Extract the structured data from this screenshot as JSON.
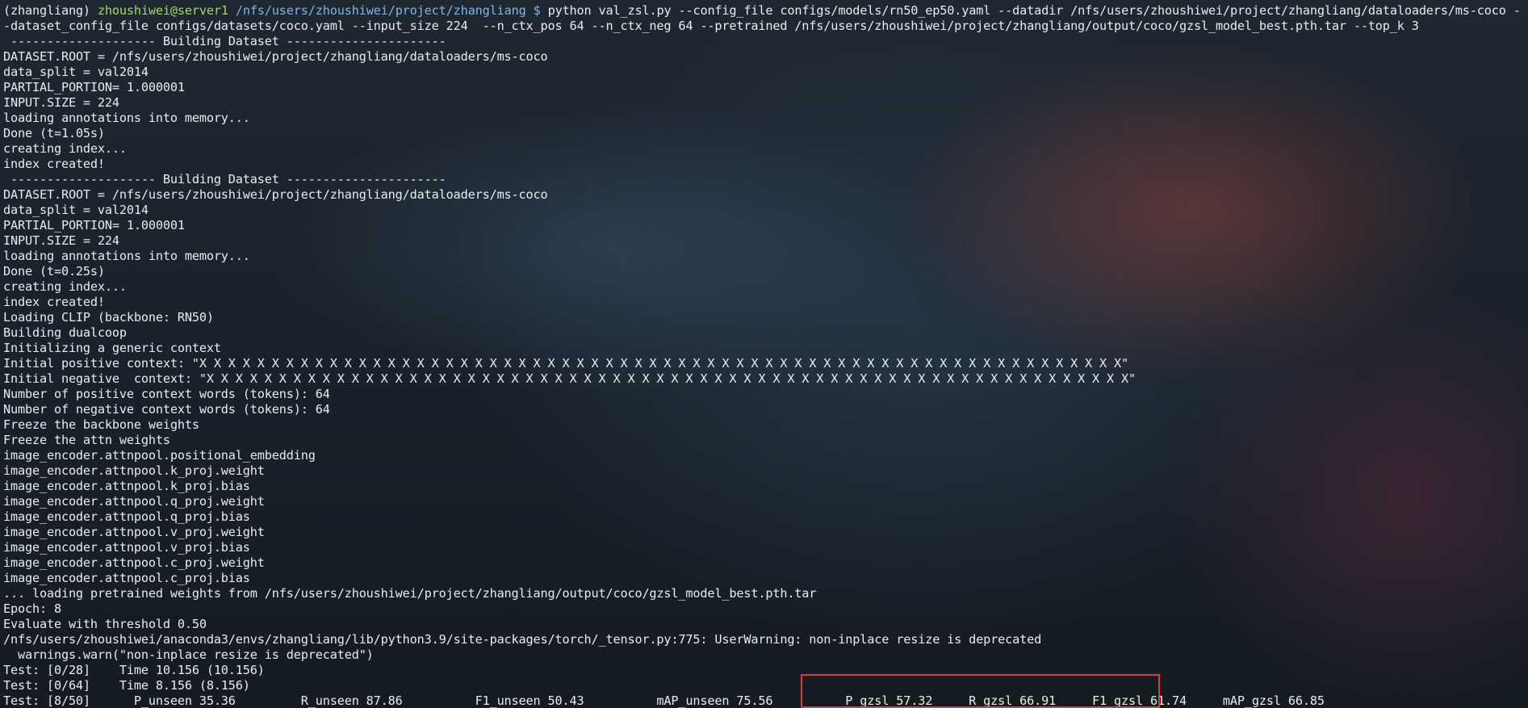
{
  "prompt": {
    "env": "(zhangliang)",
    "user_host": "zhoushiwei@server1",
    "cwd": "/nfs/users/zhoushiwei/project/zhangliang",
    "symbol": "$",
    "command_line1": "python val_zsl.py --config_file configs/models/rn50_ep50.yaml --datadir /nfs/users/zhoushiwei/project/zhangliang/dataloaders/ms-coco -",
    "command_line2": "-dataset_config_file configs/datasets/coco.yaml --input_size 224  --n_ctx_pos 64 --n_ctx_neg 64 --pretrained /nfs/users/zhoushiwei/project/zhangliang/output/coco/gzsl_model_best.pth.tar --top_k 3"
  },
  "output_lines": [
    " -------------------- Building Dataset ----------------------",
    "DATASET.ROOT = /nfs/users/zhoushiwei/project/zhangliang/dataloaders/ms-coco",
    "data_split = val2014",
    "PARTIAL_PORTION= 1.000001",
    "INPUT.SIZE = 224",
    "loading annotations into memory...",
    "Done (t=1.05s)",
    "creating index...",
    "index created!",
    " -------------------- Building Dataset ----------------------",
    "DATASET.ROOT = /nfs/users/zhoushiwei/project/zhangliang/dataloaders/ms-coco",
    "data_split = val2014",
    "PARTIAL_PORTION= 1.000001",
    "INPUT.SIZE = 224",
    "loading annotations into memory...",
    "Done (t=0.25s)",
    "creating index...",
    "index created!",
    "Loading CLIP (backbone: RN50)",
    "Building dualcoop",
    "Initializing a generic context",
    "Initial positive context: \"X X X X X X X X X X X X X X X X X X X X X X X X X X X X X X X X X X X X X X X X X X X X X X X X X X X X X X X X X X X X X X X X\"",
    "Initial negative  context: \"X X X X X X X X X X X X X X X X X X X X X X X X X X X X X X X X X X X X X X X X X X X X X X X X X X X X X X X X X X X X X X X X\"",
    "Number of positive context words (tokens): 64",
    "Number of negative context words (tokens): 64",
    "Freeze the backbone weights",
    "Freeze the attn weights",
    "image_encoder.attnpool.positional_embedding",
    "image_encoder.attnpool.k_proj.weight",
    "image_encoder.attnpool.k_proj.bias",
    "image_encoder.attnpool.q_proj.weight",
    "image_encoder.attnpool.q_proj.bias",
    "image_encoder.attnpool.v_proj.weight",
    "image_encoder.attnpool.v_proj.bias",
    "image_encoder.attnpool.c_proj.weight",
    "image_encoder.attnpool.c_proj.bias",
    "... loading pretrained weights from /nfs/users/zhoushiwei/project/zhangliang/output/coco/gzsl_model_best.pth.tar",
    "Epoch: 8",
    "Evaluate with threshold 0.50",
    "/nfs/users/zhoushiwei/anaconda3/envs/zhangliang/lib/python3.9/site-packages/torch/_tensor.py:775: UserWarning: non-inplace resize is deprecated",
    "  warnings.warn(\"non-inplace resize is deprecated\")",
    "Test: [0/28]    Time 10.156 (10.156)",
    "Test: [0/64]    Time 8.156 (8.156)",
    "Test: [8/50]      P_unseen 35.36         R_unseen 87.86          F1_unseen 50.43          mAP_unseen 75.56          P_gzsl 57.32     R_gzsl 66.91     F1_gzsl 61.74     mAP_gzsl 66.85"
  ],
  "highlight": {
    "color": "#e03a3a"
  }
}
